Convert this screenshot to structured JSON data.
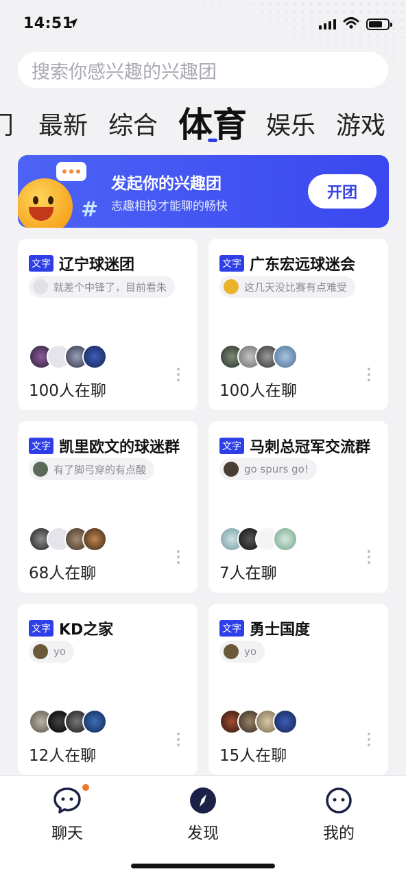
{
  "status": {
    "time": "14:51"
  },
  "search": {
    "placeholder": "搜索你感兴趣的兴趣团"
  },
  "tabs": [
    {
      "label": "门"
    },
    {
      "label": "最新"
    },
    {
      "label": "综合"
    },
    {
      "label": "体育",
      "active": true
    },
    {
      "label": "娱乐"
    },
    {
      "label": "游戏"
    }
  ],
  "banner": {
    "title": "发起你的兴趣团",
    "subtitle": "志趣相投才能聊的畅快",
    "button": "开团"
  },
  "cards": [
    {
      "tag": "文字",
      "title": "辽宁球迷团",
      "message": "就差个中锋了，目前看朱",
      "count": "100人在聊"
    },
    {
      "tag": "文字",
      "title": "广东宏远球迷会",
      "message": "这几天没比赛有点难受",
      "count": "100人在聊"
    },
    {
      "tag": "文字",
      "title": "凯里欧文的球迷群",
      "message": "有了脚弓穿的有点酸",
      "count": "68人在聊"
    },
    {
      "tag": "文字",
      "title": "马刺总冠军交流群",
      "message": "go spurs go!",
      "count": "7人在聊"
    },
    {
      "tag": "文字",
      "title": "KD之家",
      "message": "yo",
      "count": "12人在聊"
    },
    {
      "tag": "文字",
      "title": "勇士国度",
      "message": "yo",
      "count": "15人在聊"
    }
  ],
  "nav": [
    {
      "label": "聊天",
      "icon": "chat-icon",
      "badge": true
    },
    {
      "label": "发现",
      "icon": "compass-icon",
      "active": true
    },
    {
      "label": "我的",
      "icon": "profile-icon"
    }
  ],
  "colors": {
    "accent": "#2f3fe8",
    "badge": "#f0782d"
  }
}
